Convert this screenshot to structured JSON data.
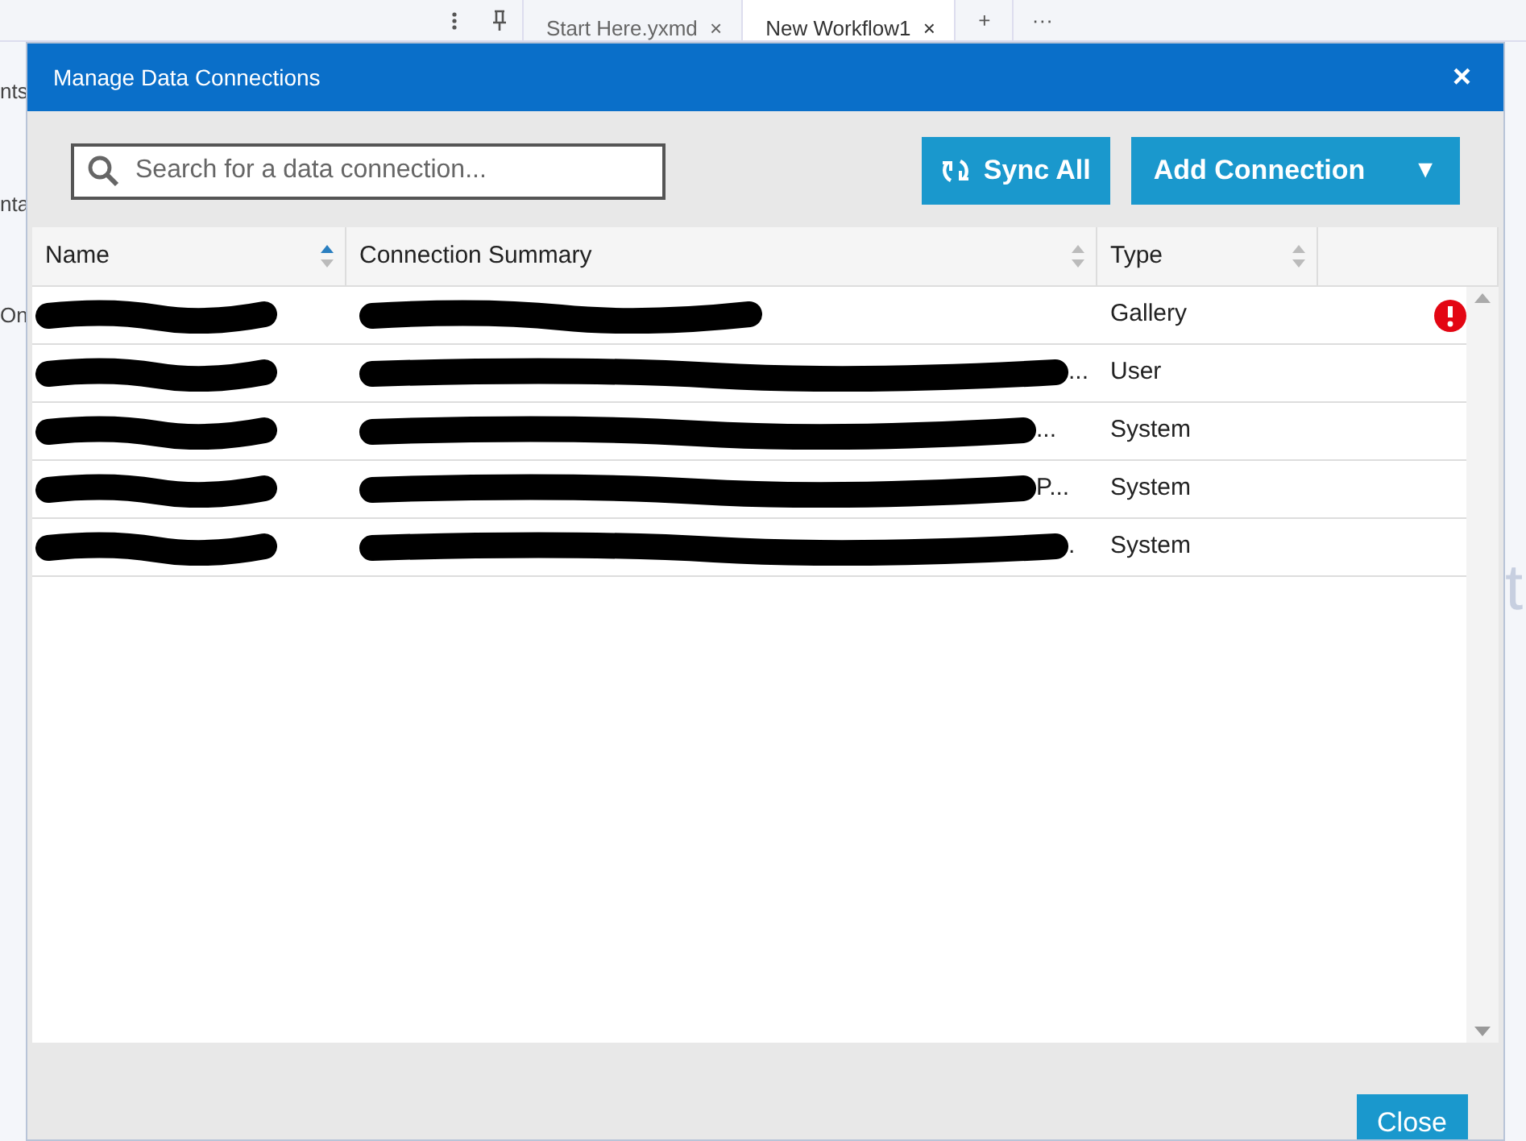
{
  "background": {
    "tabs": [
      {
        "label": "Start Here.yxmd",
        "close": "×",
        "selected": false
      },
      {
        "label": "New Workflow1",
        "close": "×",
        "selected": true
      }
    ],
    "tab_actions": [
      "+",
      "···"
    ],
    "side_fragments": [
      "nts",
      "nta",
      "On"
    ],
    "right_fragment": "t"
  },
  "dialog": {
    "title": "Manage Data Connections",
    "close": "×",
    "search": {
      "placeholder": "Search for a data connection..."
    },
    "buttons": [
      {
        "kind": "sync",
        "label": "Sync All"
      },
      {
        "kind": "split",
        "label": "Add Connection",
        "caret": "▼"
      }
    ],
    "table": {
      "columns": [
        {
          "label": "Name",
          "sorted": true
        },
        {
          "label": "Connection Summary",
          "sorted": false
        },
        {
          "label": "Type",
          "sorted": false
        }
      ],
      "rows": [
        {
          "name_redacted": true,
          "summary_redacted": true,
          "summary_tail": "",
          "type": "Gallery",
          "warning": true
        },
        {
          "name_redacted": true,
          "summary_redacted": true,
          "summary_tail": "...",
          "type": "User",
          "warning": false
        },
        {
          "name_redacted": true,
          "summary_redacted": true,
          "summary_tail": "...",
          "type": "System",
          "warning": false
        },
        {
          "name_redacted": true,
          "summary_redacted": true,
          "summary_tail": "P...",
          "type": "System",
          "warning": false
        },
        {
          "name_redacted": true,
          "summary_redacted": true,
          "summary_tail": ".",
          "type": "System",
          "warning": false
        }
      ]
    },
    "footer_button": "Close"
  }
}
